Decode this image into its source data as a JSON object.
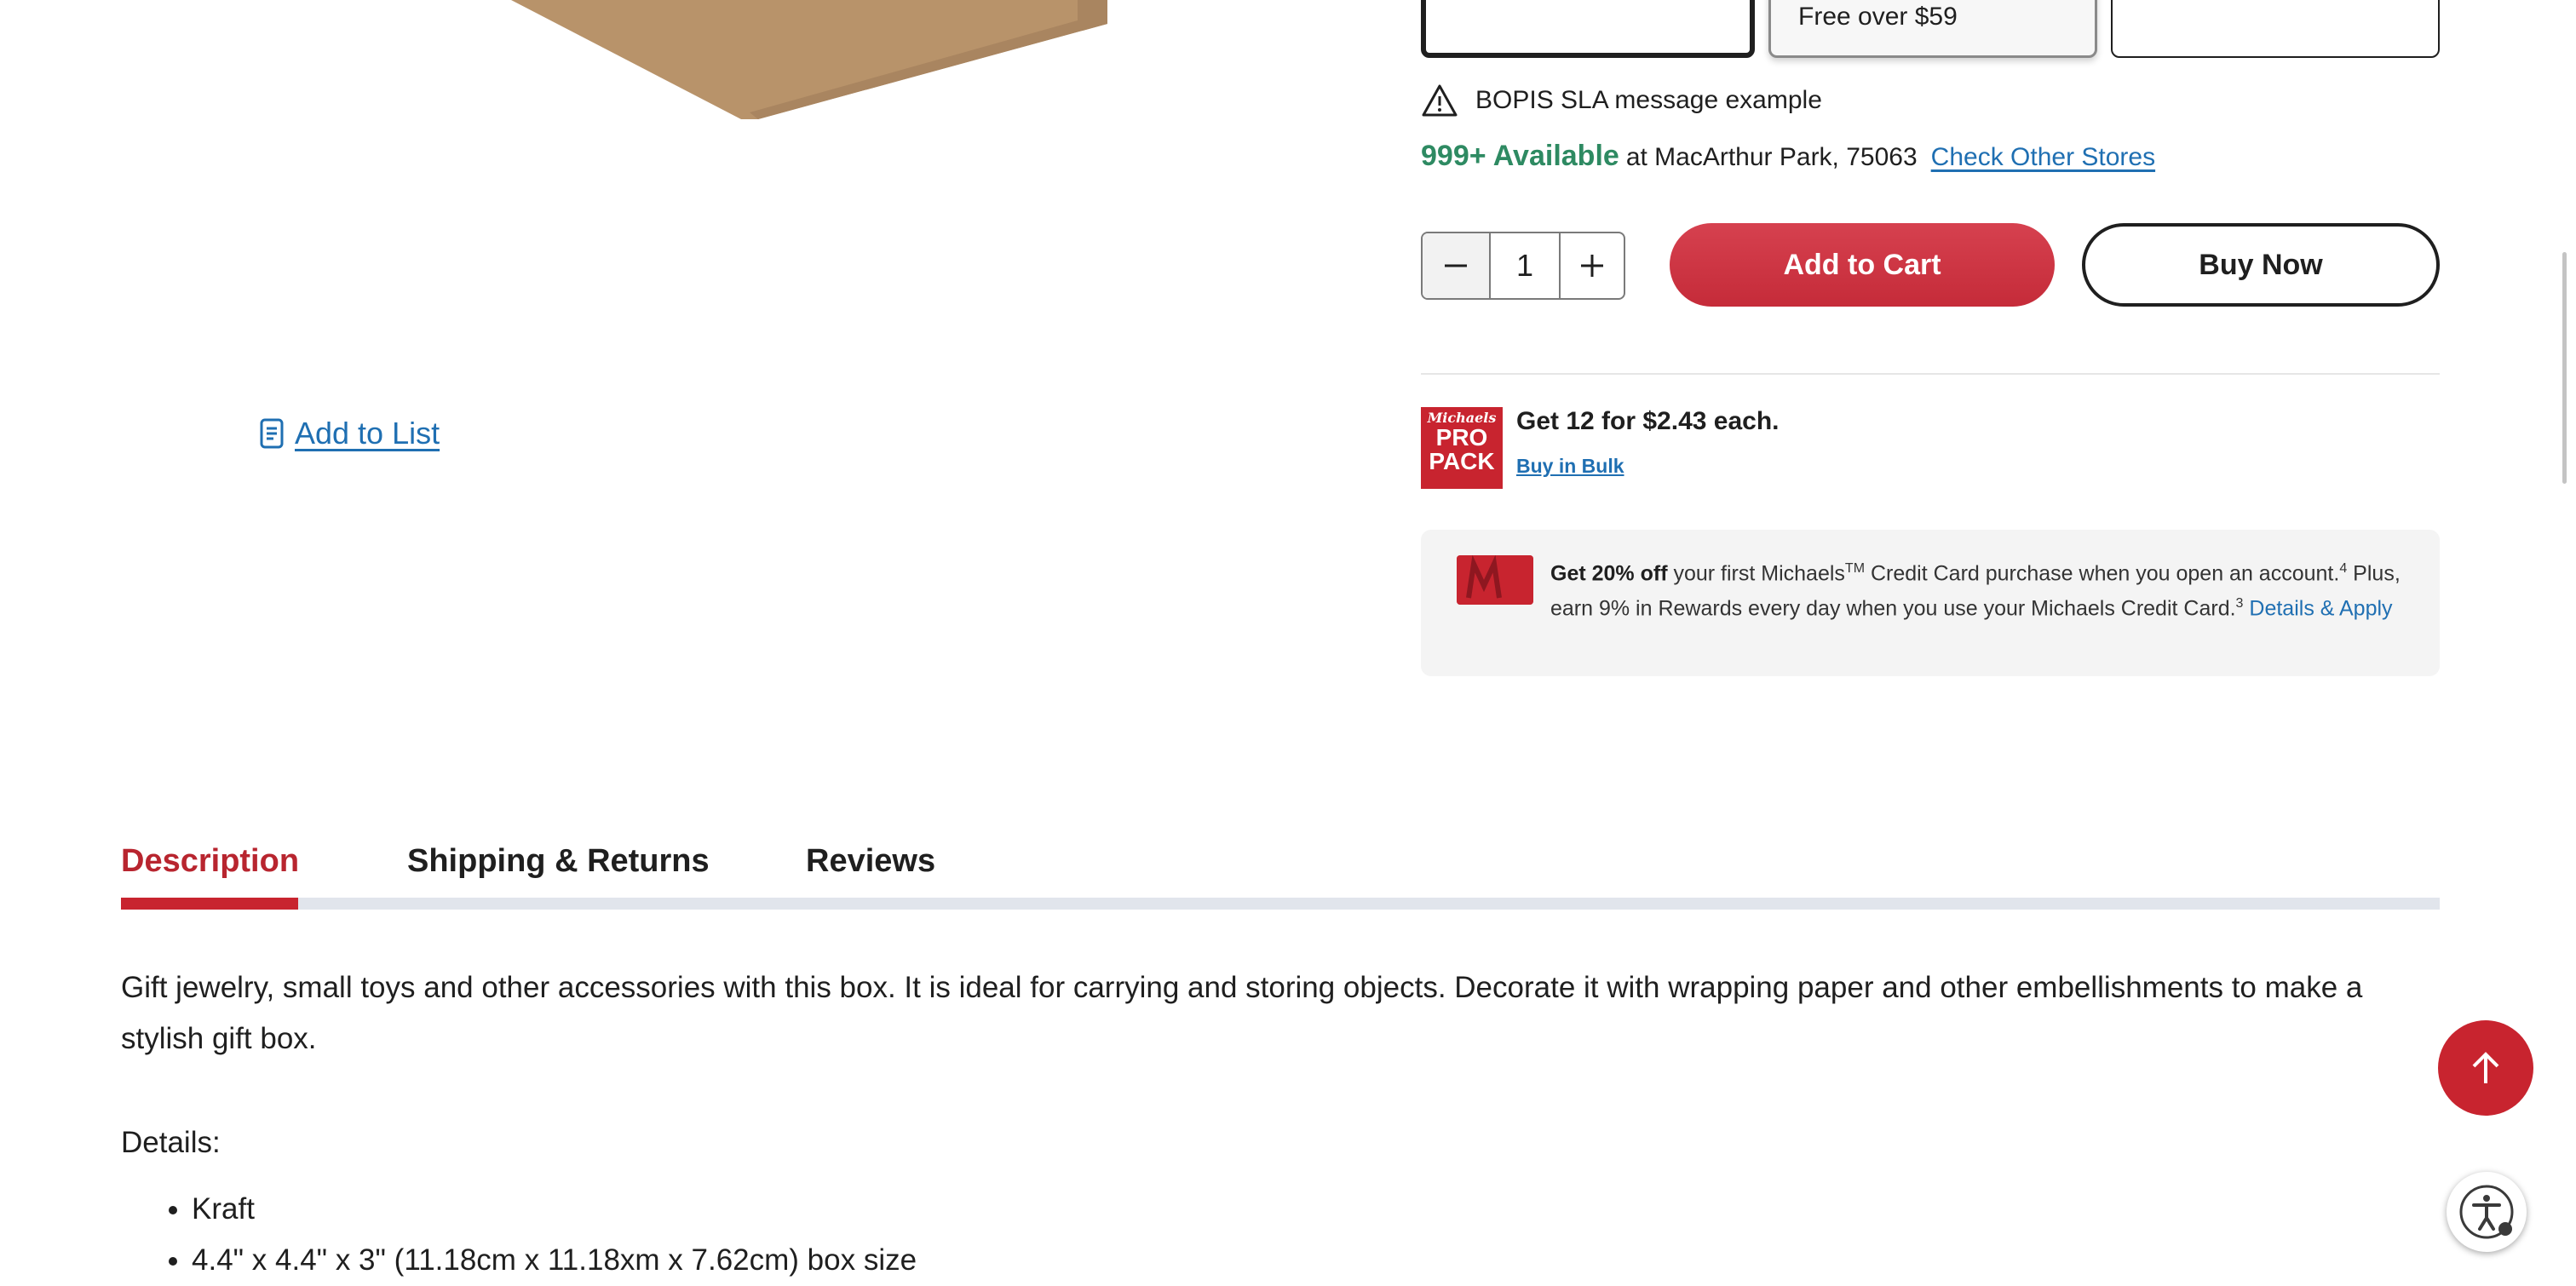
{
  "add_to_list": {
    "label": "Add to List",
    "icon": "list-document-icon"
  },
  "shipping_options": {
    "option2_text": "Free over $59"
  },
  "sla_message": {
    "icon": "warning-triangle-icon",
    "text": "BOPIS SLA message example"
  },
  "availability": {
    "count": "999+ Available",
    "location": "at MacArthur Park, 75063",
    "check_link": "Check Other Stores"
  },
  "quantity": {
    "value": "1",
    "minus_icon": "minus-icon",
    "plus_icon": "plus-icon"
  },
  "buttons": {
    "add_to_cart": "Add to Cart",
    "buy_now": "Buy Now"
  },
  "pro_pack": {
    "logo_brand": "Michaels",
    "logo_line1": "PRO",
    "logo_line2": "PACK",
    "headline": "Get 12 for $2.43 each.",
    "link": "Buy in Bulk"
  },
  "credit_promo": {
    "bold": "Get 20% off",
    "text1": " your first Michaels",
    "tm": "TM",
    "text2": " Credit Card purchase when you open an account.",
    "sup1": "4",
    "text3": " Plus, earn 9% in Rewards every day when you use your Michaels Credit Card.",
    "sup2": "3",
    "link": " Details & Apply"
  },
  "tabs": [
    {
      "label": "Description",
      "active": true
    },
    {
      "label": "Shipping & Returns",
      "active": false
    },
    {
      "label": "Reviews",
      "active": false
    }
  ],
  "description": {
    "text": "Gift jewelry, small toys and other accessories with this box. It is ideal for carrying and storing objects. Decorate it with wrapping paper and other embellishments to make a stylish gift box.",
    "details_label": "Details:",
    "details": [
      "Kraft",
      "4.4\" x 4.4\" x 3\" (11.18cm x 11.18xm x 7.62cm) box size"
    ]
  },
  "colors": {
    "accent_red": "#c8242f",
    "link_blue": "#1f6fb2",
    "available_green": "#2e8a62"
  },
  "floating": {
    "to_top_icon": "arrow-up-icon",
    "accessibility_icon": "accessibility-icon"
  }
}
